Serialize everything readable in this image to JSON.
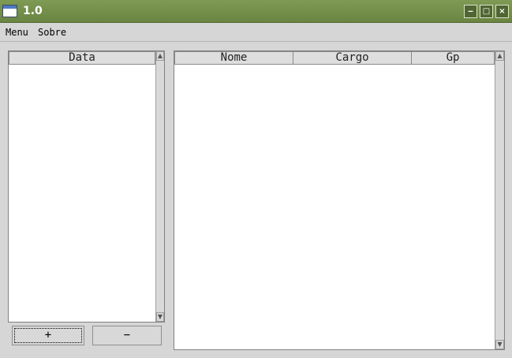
{
  "window": {
    "title": "1.0",
    "minimize": "‒",
    "maximize": "□",
    "close": "×"
  },
  "menubar": {
    "menu": "Menu",
    "sobre": "Sobre"
  },
  "left_list": {
    "column": "Data",
    "rows": []
  },
  "right_table": {
    "columns": [
      "Nome",
      "Cargo",
      "Gp"
    ],
    "rows": []
  },
  "buttons": {
    "add": "+",
    "remove": "−"
  },
  "scroll": {
    "up": "▲",
    "down": "▼"
  }
}
